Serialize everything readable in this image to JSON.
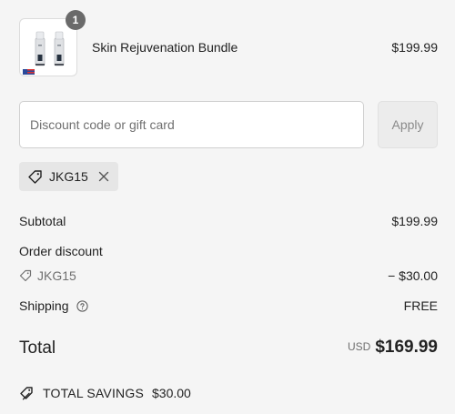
{
  "product": {
    "quantity_badge": "1",
    "name": "Skin Rejuvenation Bundle",
    "price": "$199.99"
  },
  "discount": {
    "placeholder": "Discount code or gift card",
    "value": "",
    "apply_label": "Apply"
  },
  "applied_code": {
    "code": "JKG15",
    "icon": "tag-icon",
    "remove_icon": "close-icon"
  },
  "summary": {
    "subtotal_label": "Subtotal",
    "subtotal_value": "$199.99",
    "order_discount_label": "Order discount",
    "discount_code": "JKG15",
    "discount_value": "− $30.00",
    "shipping_label": "Shipping",
    "shipping_value": "FREE",
    "total_label": "Total",
    "total_currency": "USD",
    "total_value": "$169.99"
  },
  "savings": {
    "label": "TOTAL SAVINGS",
    "amount": "$30.00"
  },
  "colors": {
    "background": "#f5f5f5",
    "chip_background": "#e6e6e6",
    "badge": "#6a6a6a"
  }
}
